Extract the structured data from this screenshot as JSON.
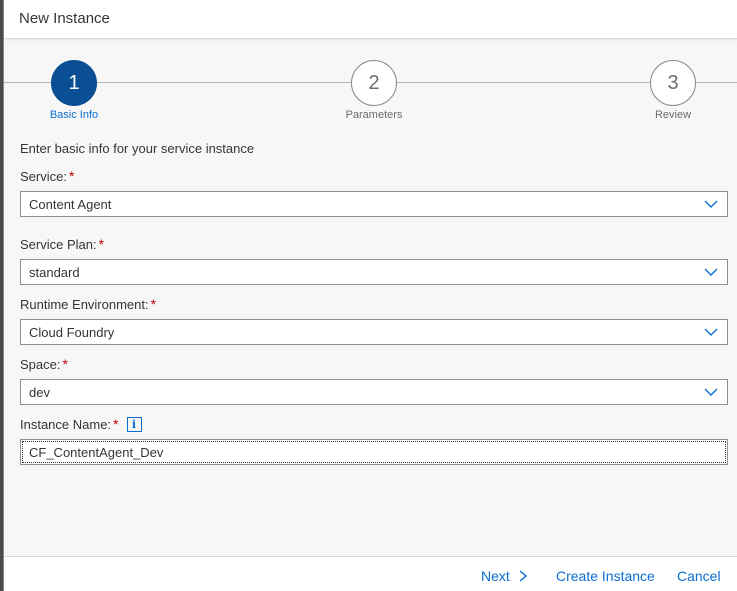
{
  "dialog": {
    "title": "New Instance"
  },
  "wizard": {
    "steps": [
      {
        "number": "1",
        "label": "Basic Info"
      },
      {
        "number": "2",
        "label": "Parameters"
      },
      {
        "number": "3",
        "label": "Review"
      }
    ],
    "active_step": 1
  },
  "form": {
    "intro": "Enter basic info for your service instance",
    "required_marker": "*",
    "service": {
      "label": "Service:",
      "value": "Content Agent"
    },
    "service_plan": {
      "label": "Service Plan:",
      "value": "standard"
    },
    "runtime_environment": {
      "label": "Runtime Environment:",
      "value": "Cloud Foundry"
    },
    "space": {
      "label": "Space:",
      "value": "dev"
    },
    "instance_name": {
      "label": "Instance Name:",
      "value": "CF_ContentAgent_Dev",
      "info_glyph": "i"
    }
  },
  "footer": {
    "next_label": "Next",
    "create_label": "Create Instance",
    "cancel_label": "Cancel"
  },
  "colors": {
    "accent": "#0a6ed1",
    "active_step": "#0a4f93",
    "required": "#bb0000"
  }
}
